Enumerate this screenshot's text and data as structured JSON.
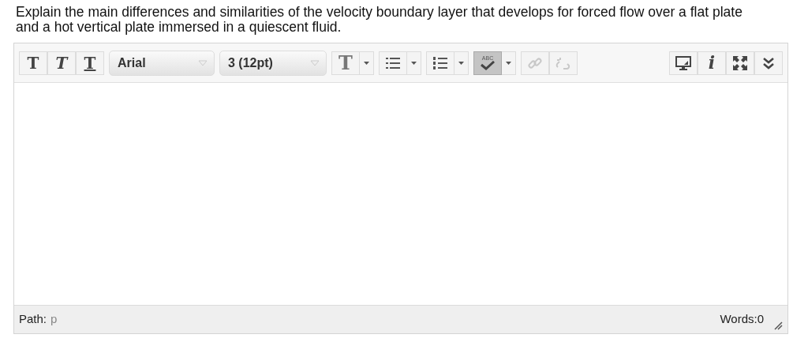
{
  "question": "Explain the main differences and similarities of the velocity boundary layer that develops for forced flow over a flat plate and a hot vertical plate immersed in a quiescent fluid.",
  "toolbar": {
    "format_buttons": [
      {
        "kind": "bold",
        "label": "T"
      },
      {
        "kind": "italic",
        "label": "T"
      },
      {
        "kind": "underline",
        "label": "T"
      }
    ],
    "font": {
      "value": "Arial"
    },
    "size": {
      "value": "3 (12pt)"
    },
    "tools": [
      {
        "kind": "text-color",
        "label": "T",
        "selected": false,
        "disabled": false
      },
      {
        "kind": "bullets",
        "selected": false,
        "disabled": false
      },
      {
        "kind": "numbers",
        "selected": false,
        "disabled": false
      },
      {
        "kind": "spellcheck",
        "label": "ABC",
        "selected": true,
        "disabled": false
      }
    ],
    "links": [
      {
        "kind": "link",
        "disabled": true
      },
      {
        "kind": "unlink",
        "disabled": true
      }
    ],
    "right": [
      {
        "kind": "preview"
      },
      {
        "kind": "info",
        "label": "i"
      },
      {
        "kind": "fullscreen"
      },
      {
        "kind": "more"
      }
    ]
  },
  "status_bar": {
    "path_label": "Path:",
    "path": "p",
    "words": "Words:0"
  }
}
